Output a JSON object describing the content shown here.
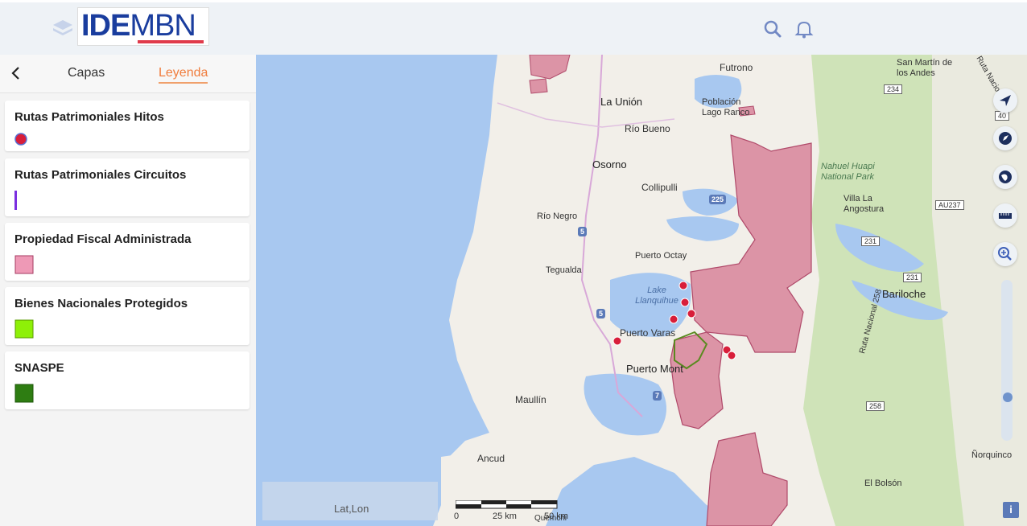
{
  "header": {
    "logo_ide": "IDE",
    "logo_mbn": "MBN"
  },
  "panel": {
    "tabs": [
      {
        "label": "Capas",
        "active": false
      },
      {
        "label": "Leyenda",
        "active": true
      }
    ],
    "legend": [
      {
        "title": "Rutas Patrimoniales Hitos",
        "symbol": "red-dot-icon",
        "color": "#d81e3a"
      },
      {
        "title": "Rutas Patrimoniales Circuitos",
        "symbol": "purple-line-icon",
        "color": "#7b2fe0"
      },
      {
        "title": "Propiedad Fiscal Administrada",
        "symbol": "pink-square-icon",
        "color": "#ee99b6"
      },
      {
        "title": "Bienes Nacionales Protegidos",
        "symbol": "lime-square-icon",
        "color": "#8ef008"
      },
      {
        "title": "SNASPE",
        "symbol": "green-square-icon",
        "color": "#2e7d12"
      }
    ]
  },
  "map": {
    "places": {
      "futrono": "Futrono",
      "san_martin": "San Martín de los Andes",
      "la_union": "La Unión",
      "lago_ranco": "Población Lago Ranco",
      "rio_bueno": "Río Bueno",
      "osorno": "Osorno",
      "collipulli": "Collipulli",
      "nahuel_huapi": "Nahuel Huapi National Park",
      "villa_la_angostura": "Villa La Angostura",
      "rio_negro": "Río Negro",
      "puerto_octay": "Puerto Octay",
      "tegualda": "Tegualda",
      "lake_llanquihue": "Lake Llanquihue",
      "bariloche": "Bariloche",
      "puerto_varas": "Puerto Varas",
      "puerto_montt": "Puerto Mont",
      "maullin": "Maullín",
      "ancud": "Ancud",
      "norquinco": "Ñorquinco",
      "el_bolson": "El Bolsón",
      "ruta_nacional": "Ruta Nacional 258",
      "ruta_nacional_top": "Ruta Nacional",
      "quemchi": "Quemchi"
    },
    "shields": [
      "5",
      "5",
      "225",
      "7",
      "234",
      "40",
      "AU237",
      "231",
      "231",
      "258"
    ],
    "latlon_label": "Lat,Lon",
    "scale": {
      "zero": "0",
      "mid": "25 km",
      "max": "50 km"
    },
    "info_label": "i"
  }
}
